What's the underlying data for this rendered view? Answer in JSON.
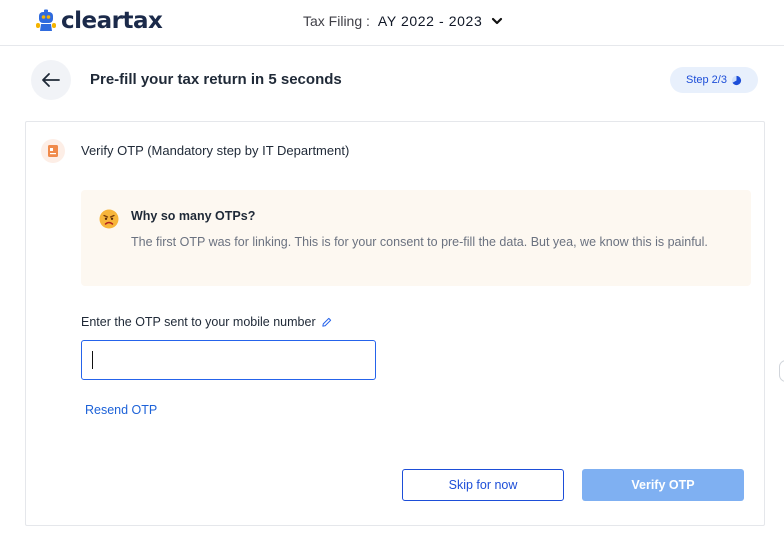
{
  "topbar": {
    "brand": "cleartax",
    "tax_filing_label": "Tax Filing :",
    "assessment_year": "AY 2022 - 2023"
  },
  "header": {
    "title": "Pre-fill your tax return in 5 seconds",
    "step": "Step 2/3",
    "step_progress": 0.67
  },
  "card": {
    "title": "Verify OTP (Mandatory step by IT Department)",
    "info": {
      "title": "Why so many OTPs?",
      "text": "The first OTP was for linking. This is for your consent to pre-fill the data. But yea, we know this is painful."
    },
    "otp_label": "Enter the OTP sent to your mobile number",
    "otp_value": "",
    "resend_label": "Resend OTP",
    "skip_label": "Skip for now",
    "verify_label": "Verify OTP"
  },
  "colors": {
    "brand_dark": "#1b2a4a",
    "primary": "#1d4ed8",
    "primary_disabled": "#7fb0f2",
    "info_bg": "#fdf8f1"
  }
}
